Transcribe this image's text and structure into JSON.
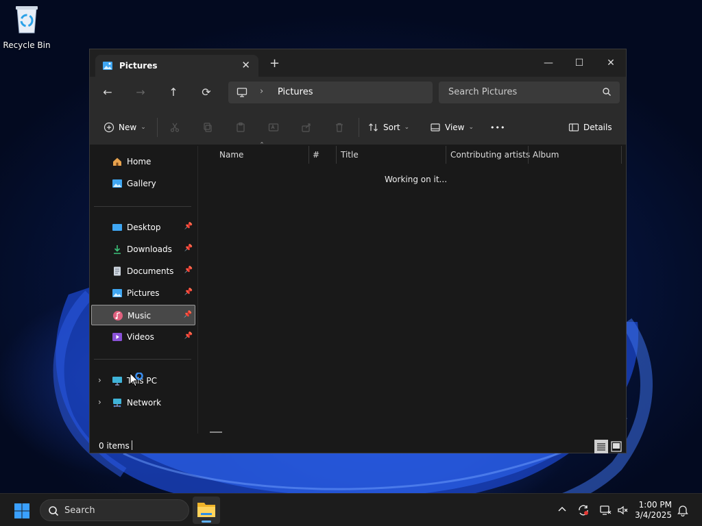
{
  "desktop": {
    "recycle_bin_label": "Recycle Bin"
  },
  "window": {
    "tab_title": "Pictures",
    "tab_close": "✕",
    "new_tab": "+",
    "minimize": "—",
    "maximize": "☐",
    "close": "✕"
  },
  "nav": {
    "back": "←",
    "forward": "→",
    "up": "↑",
    "refresh": "⟳",
    "breadcrumb_sep": "›",
    "breadcrumb": "Pictures",
    "search_placeholder": "Search Pictures"
  },
  "toolbar": {
    "new_label": "New",
    "sort_label": "Sort",
    "view_label": "View",
    "more_label": "•••",
    "details_label": "Details"
  },
  "sidebar": {
    "home": "Home",
    "gallery": "Gallery",
    "items": [
      {
        "label": "Desktop"
      },
      {
        "label": "Downloads"
      },
      {
        "label": "Documents"
      },
      {
        "label": "Pictures"
      },
      {
        "label": "Music"
      },
      {
        "label": "Videos"
      }
    ],
    "this_pc": "This PC",
    "network": "Network"
  },
  "columns": {
    "name": "Name",
    "number": "#",
    "title": "Title",
    "artists": "Contributing artists",
    "album": "Album"
  },
  "content": {
    "status_message": "Working on it..."
  },
  "statusbar": {
    "item_count": "0 items"
  },
  "taskbar": {
    "search_placeholder": "Search",
    "time": "1:00 PM",
    "date": "3/4/2025"
  },
  "colors": {
    "accent": "#5fb2ff",
    "window_bg": "#191919",
    "toolbar_bg": "#2b2b2b",
    "selected_bg": "#484848"
  }
}
